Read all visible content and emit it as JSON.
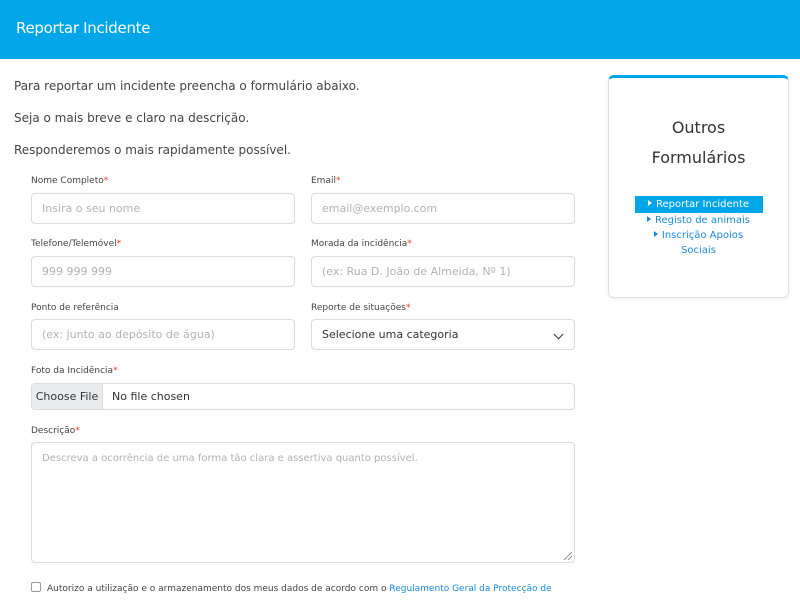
{
  "header": {
    "title": "Reportar Incidente"
  },
  "intro": {
    "line1": "Para reportar um incidente preencha o formulário abaixo.",
    "line2": "Seja o mais breve e claro na descrição.",
    "line3": "Responderemos o mais rapidamente possível."
  },
  "required_mark": "*",
  "form": {
    "name": {
      "label": "Nome Completo",
      "placeholder": "Insira o seu nome"
    },
    "email": {
      "label": "Email",
      "placeholder": "email@exemplo.com"
    },
    "phone": {
      "label": "Telefone/Telemóvel",
      "placeholder": "999 999 999"
    },
    "address": {
      "label": "Morada da incidência",
      "placeholder": "(ex: Rua D. João de Almeida, Nº 1)"
    },
    "reference": {
      "label": "Ponto de referência",
      "placeholder": "(ex: junto ao depósito de água)"
    },
    "category": {
      "label": "Reporte de situações",
      "selected": "Selecione uma categoria"
    },
    "photo": {
      "label": "Foto da Incidência",
      "button": "Choose File",
      "status": "No file chosen"
    },
    "description": {
      "label": "Descrição",
      "placeholder": "Descreva a ocorrência de uma forma tão clara e assertiva quanto possível."
    },
    "consent": {
      "text": "Autorizo a utilização e o armazenamento dos meus dados de acordo com o ",
      "link": "Regulamento Geral da Protecção de"
    }
  },
  "sidebar": {
    "heading_line1": "Outros",
    "heading_line2": "Formulários",
    "items": [
      {
        "label": "Reportar Incidente",
        "active": true
      },
      {
        "label": "Registo de animais",
        "active": false
      },
      {
        "label": "Inscrição Apoios",
        "active": false
      },
      {
        "label": "Sociais",
        "active": false
      }
    ]
  },
  "colors": {
    "accent": "#00a6e8",
    "link": "#1a8ad9",
    "required": "#e53935"
  }
}
